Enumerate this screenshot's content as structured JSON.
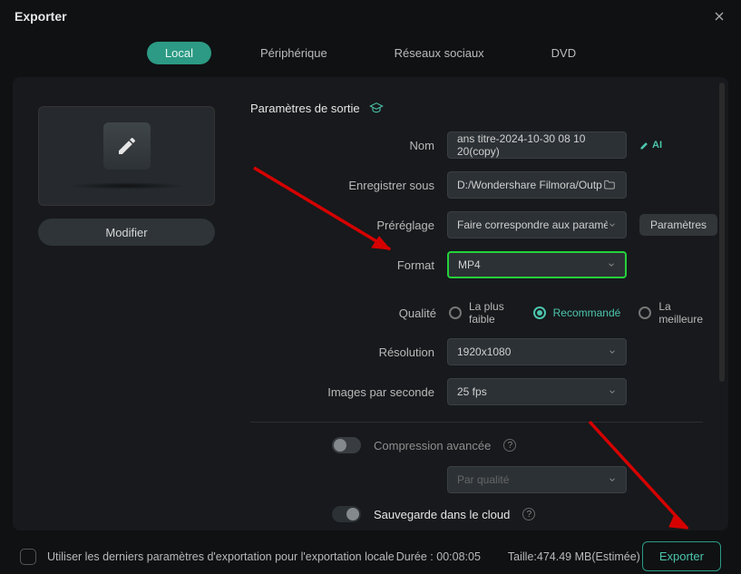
{
  "window": {
    "title": "Exporter"
  },
  "tabs": {
    "local": "Local",
    "device": "Périphérique",
    "social": "Réseaux sociaux",
    "dvd": "DVD"
  },
  "section": {
    "output": "Paramètres de sortie"
  },
  "labels": {
    "name": "Nom",
    "saveTo": "Enregistrer sous",
    "preset": "Préréglage",
    "format": "Format",
    "quality": "Qualité",
    "resolution": "Résolution",
    "fps": "Images par seconde",
    "compression": "Compression avancée",
    "byQuality": "Par qualité",
    "cloud": "Sauvegarde dans le cloud"
  },
  "values": {
    "name": "ans titre-2024-10-30 08 10 20(copy)",
    "saveTo": "D:/Wondershare Filmora/Outp",
    "preset": "Faire correspondre aux paramètres",
    "format": "MP4",
    "resolution": "1920x1080",
    "fps": "25 fps"
  },
  "quality": {
    "low": "La plus faible",
    "rec": "Recommandé",
    "high": "La meilleure"
  },
  "buttons": {
    "modify": "Modifier",
    "params": "Paramètres",
    "export": "Exporter",
    "ai": "AI"
  },
  "footer": {
    "remember": "Utiliser les derniers paramètres d'exportation pour l'exportation locale",
    "durationLabel": "Durée :",
    "duration": "00:08:05",
    "sizeLabel": "Taille:",
    "size": "474.49 MB(Estimée)"
  }
}
